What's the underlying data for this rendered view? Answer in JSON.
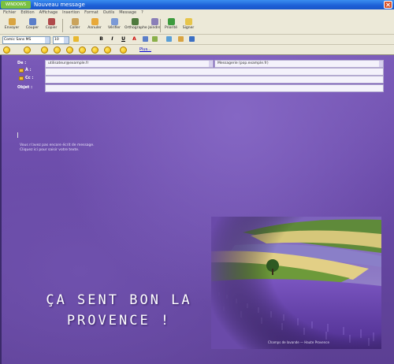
{
  "window": {
    "badge": "WINDOWS MAIL",
    "title": "Nouveau message"
  },
  "menu": [
    "Fichier",
    "Edition",
    "Affichage",
    "Insertion",
    "Format",
    "Outils",
    "Message",
    "?"
  ],
  "toolbar": {
    "send": "Envoyer",
    "cut": "Couper",
    "copy": "Copier",
    "paste": "Coller",
    "undo": "Annuler",
    "check": "Vérifier",
    "spelling": "Orthographe",
    "attach": "Joindre",
    "priority": "Priorité",
    "sign": "Signer",
    "encrypt": "Chiffrer"
  },
  "format_bar": {
    "font": "Comic Sans MS",
    "size": "10"
  },
  "emoticons_link": "Plus...",
  "header": {
    "from_label": "De :",
    "from_value": "utilisateur@example.fr",
    "from_account": "Messagerie (pop.example.fr)",
    "to_label": "À :",
    "cc_label": "Cc :",
    "subject_label": "Objet :"
  },
  "body": {
    "line1": "Vous n'avez pas encore écrit de message.",
    "line2": "Cliquez ici pour saisir votre texte."
  },
  "slogan": {
    "line1": "ÇA SENT BON LA",
    "line2": "PROVENCE !"
  },
  "photo_caption": "Champs de lavande — Haute Provence",
  "colors": {
    "accent": "#6a4aa9",
    "lavender": "#7a55c0",
    "title_bar": "#1c5fd6"
  },
  "icons": [
    "send-icon",
    "cut-icon",
    "copy-icon",
    "paste-icon",
    "undo-icon",
    "check-icon",
    "spell-icon",
    "attach-icon",
    "priority-icon",
    "close-icon"
  ]
}
